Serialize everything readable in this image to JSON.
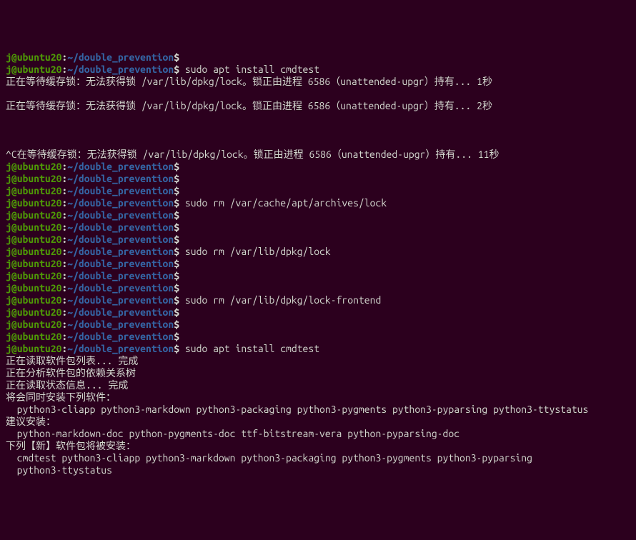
{
  "prompt": {
    "user": "j",
    "at": "@",
    "host": "ubuntu20",
    "colon": ":",
    "path": "~/double_prevention",
    "dollar": "$"
  },
  "lines": [
    {
      "type": "prompt",
      "cmd": ""
    },
    {
      "type": "prompt",
      "cmd": " sudo apt install cmdtest"
    },
    {
      "type": "output",
      "text": "正在等待缓存锁：无法获得锁 /var/lib/dpkg/lock。锁正由进程 6586（unattended-upgr）持有... 1秒"
    },
    {
      "type": "blank"
    },
    {
      "type": "output",
      "text": "正在等待缓存锁：无法获得锁 /var/lib/dpkg/lock。锁正由进程 6586（unattended-upgr）持有... 2秒"
    },
    {
      "type": "blank"
    },
    {
      "type": "blank"
    },
    {
      "type": "blank"
    },
    {
      "type": "output",
      "text": "^C在等待缓存锁：无法获得锁 /var/lib/dpkg/lock。锁正由进程 6586（unattended-upgr）持有... 11秒"
    },
    {
      "type": "prompt",
      "cmd": ""
    },
    {
      "type": "prompt",
      "cmd": ""
    },
    {
      "type": "prompt",
      "cmd": ""
    },
    {
      "type": "prompt",
      "cmd": " sudo rm /var/cache/apt/archives/lock"
    },
    {
      "type": "prompt",
      "cmd": ""
    },
    {
      "type": "prompt",
      "cmd": ""
    },
    {
      "type": "prompt",
      "cmd": ""
    },
    {
      "type": "prompt",
      "cmd": " sudo rm /var/lib/dpkg/lock"
    },
    {
      "type": "prompt",
      "cmd": ""
    },
    {
      "type": "prompt",
      "cmd": ""
    },
    {
      "type": "prompt",
      "cmd": ""
    },
    {
      "type": "prompt",
      "cmd": " sudo rm /var/lib/dpkg/lock-frontend"
    },
    {
      "type": "prompt",
      "cmd": ""
    },
    {
      "type": "prompt",
      "cmd": ""
    },
    {
      "type": "prompt",
      "cmd": ""
    },
    {
      "type": "prompt",
      "cmd": " sudo apt install cmdtest"
    },
    {
      "type": "output",
      "text": "正在读取软件包列表... 完成"
    },
    {
      "type": "output",
      "text": "正在分析软件包的依赖关系树"
    },
    {
      "type": "output",
      "text": "正在读取状态信息... 完成"
    },
    {
      "type": "output",
      "text": "将会同时安装下列软件："
    },
    {
      "type": "output",
      "text": "  python3-cliapp python3-markdown python3-packaging python3-pygments python3-pyparsing python3-ttystatus"
    },
    {
      "type": "output",
      "text": "建议安装："
    },
    {
      "type": "output",
      "text": "  python-markdown-doc python-pygments-doc ttf-bitstream-vera python-pyparsing-doc"
    },
    {
      "type": "output",
      "text": "下列【新】软件包将被安装："
    },
    {
      "type": "output",
      "text": "  cmdtest python3-cliapp python3-markdown python3-packaging python3-pygments python3-pyparsing"
    },
    {
      "type": "output",
      "text": "  python3-ttystatus"
    }
  ]
}
